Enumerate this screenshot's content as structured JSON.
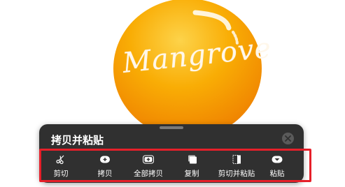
{
  "logo": {
    "text": "Mangrove",
    "colors": {
      "top": "#f9ad05",
      "bottom": "#f28a00",
      "text": "#fff7ea"
    }
  },
  "panel": {
    "title": "拷贝并粘贴",
    "close_icon": "close-icon",
    "background": "#303030"
  },
  "actions": [
    {
      "label": "剪切",
      "icon": "scissors-icon"
    },
    {
      "label": "拷贝",
      "icon": "copy-plus-icon"
    },
    {
      "label": "全部拷贝",
      "icon": "copy-all-icon"
    },
    {
      "label": "复制",
      "icon": "duplicate-icon"
    },
    {
      "label": "剪切并粘贴",
      "icon": "cut-paste-icon"
    },
    {
      "label": "粘贴",
      "icon": "paste-icon"
    }
  ],
  "annotation": {
    "highlight_color": "#e6202a"
  }
}
